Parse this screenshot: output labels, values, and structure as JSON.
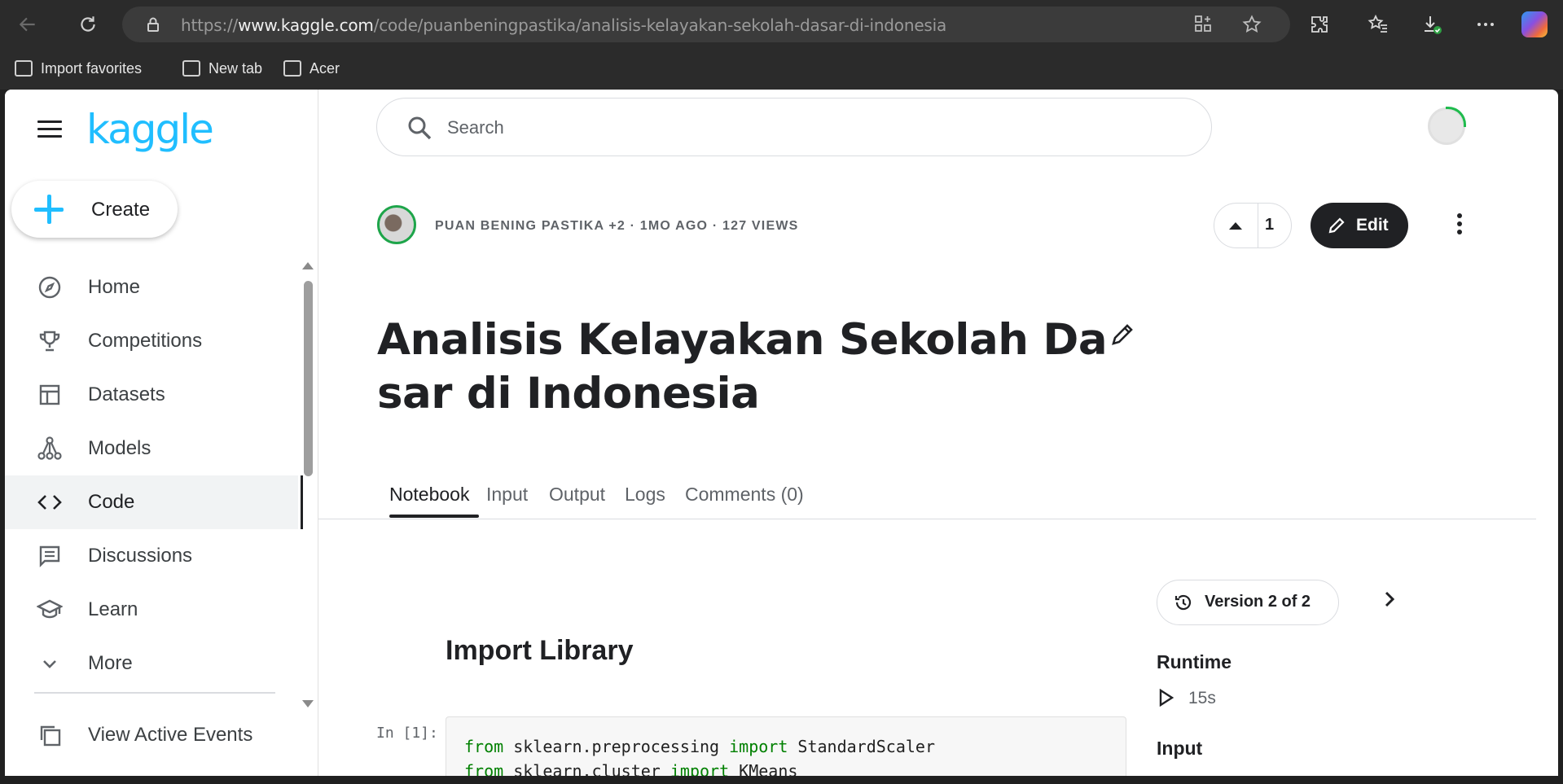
{
  "browser": {
    "url_prefix": "https://",
    "url_host": "www.kaggle.com",
    "url_path": "/code/puanbeningpastika/analisis-kelayakan-sekolah-dasar-di-indonesia",
    "bookmarks": [
      "Import favorites",
      "New tab",
      "Acer"
    ]
  },
  "sidebar": {
    "logo": "kaggle",
    "create_label": "Create",
    "items": [
      {
        "label": "Home",
        "icon": "compass-icon"
      },
      {
        "label": "Competitions",
        "icon": "trophy-icon"
      },
      {
        "label": "Datasets",
        "icon": "table-icon"
      },
      {
        "label": "Models",
        "icon": "models-icon"
      },
      {
        "label": "Code",
        "icon": "code-icon",
        "active": true
      },
      {
        "label": "Discussions",
        "icon": "discussions-icon"
      },
      {
        "label": "Learn",
        "icon": "graduation-cap-icon"
      },
      {
        "label": "More",
        "icon": "chevron-down-icon"
      }
    ],
    "events_label": "View Active Events"
  },
  "search": {
    "placeholder": "Search"
  },
  "notebook": {
    "meta": "PUAN BENING PASTIKA +2 · 1MO AGO · 127 VIEWS",
    "vote_count": "1",
    "edit_label": "Edit",
    "title": "Analisis Kelayakan Sekolah Dasar di Indonesia",
    "tabs": [
      "Notebook",
      "Input",
      "Output",
      "Logs",
      "Comments (0)"
    ],
    "active_tab": "Notebook",
    "section_heading": "Import Library",
    "cell_prompt": "In [1]:",
    "code": {
      "line1": {
        "kw1": "from",
        "mod": " sklearn.preprocessing ",
        "kw2": "import",
        "name": " StandardScaler"
      },
      "line2": {
        "kw1": "from",
        "mod": " sklearn.cluster ",
        "kw2": "import",
        "name": " KMeans"
      }
    }
  },
  "side_panel": {
    "version_label": "Version 2 of 2",
    "runtime_heading": "Runtime",
    "runtime_value": "15s",
    "input_heading": "Input"
  },
  "colors": {
    "kaggle_blue": "#20beff",
    "dark": "#202124",
    "code_keyword": "#008000"
  }
}
